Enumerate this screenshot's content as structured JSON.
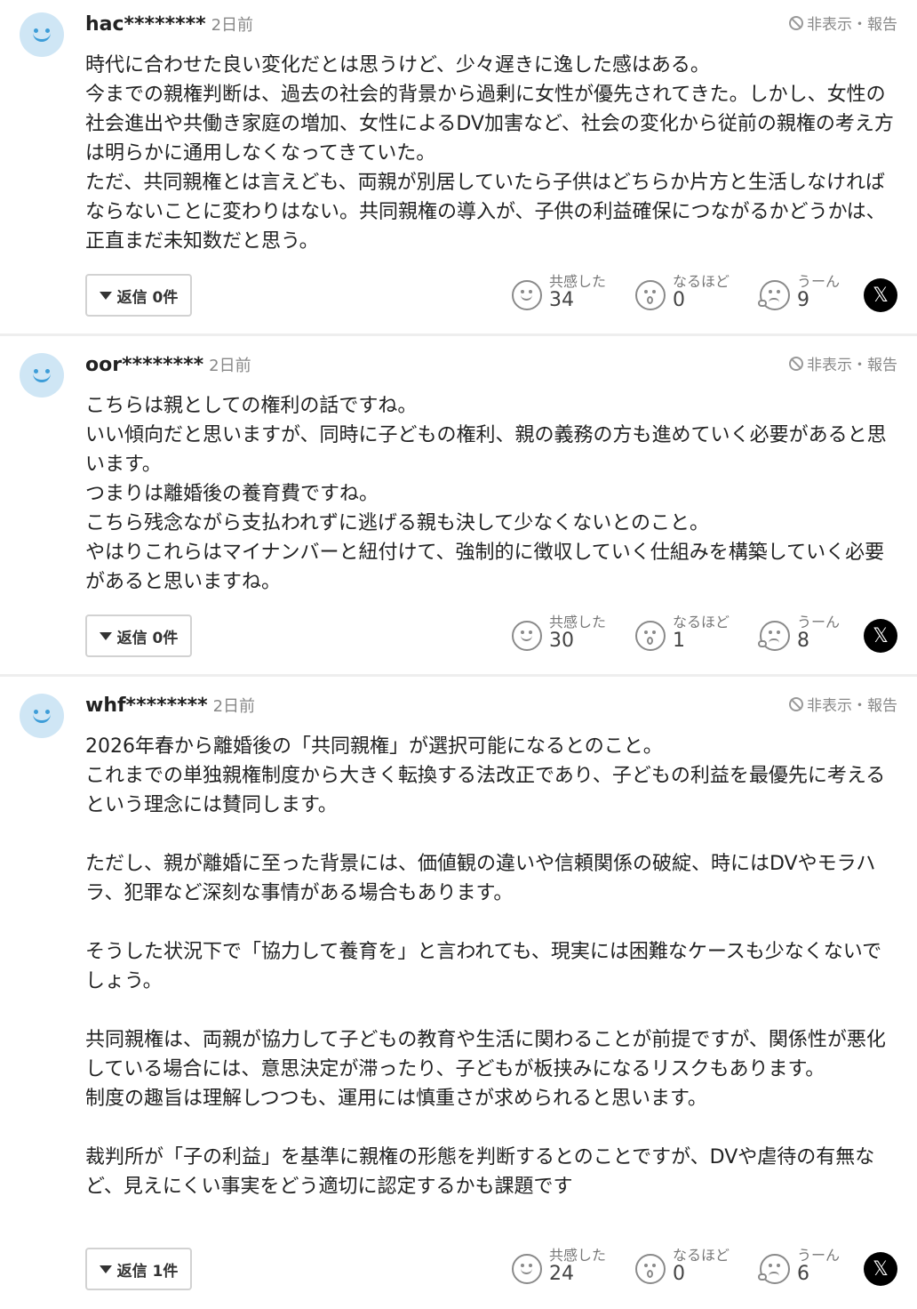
{
  "ui": {
    "hide_report_label": "非表示・報告",
    "reaction_labels": [
      "共感した",
      "なるほど",
      "うーん"
    ],
    "share_icon": "x-logo-icon"
  },
  "comments": [
    {
      "user": "hac********",
      "time": "2日前",
      "body": "時代に合わせた良い変化だとは思うけど、少々遅きに逸した感はある。\n今までの親権判断は、過去の社会的背景から過剰に女性が優先されてきた。しかし、女性の社会進出や共働き家庭の増加、女性によるDV加害など、社会の変化から従前の親権の考え方は明らかに通用しなくなってきていた。\nただ、共同親権とは言えども、両親が別居していたら子供はどちらか片方と生活しなければならないことに変わりはない。共同親権の導入が、子供の利益確保につながるかどうかは、正直まだ未知数だと思う。",
      "reply_label": "返信 0件",
      "reactions": [
        "34",
        "0",
        "9"
      ]
    },
    {
      "user": "oor********",
      "time": "2日前",
      "body": "こちらは親としての権利の話ですね。\nいい傾向だと思いますが、同時に子どもの権利、親の義務の方も進めていく必要があると思います。\nつまりは離婚後の養育費ですね。\nこちら残念ながら支払われずに逃げる親も決して少なくないとのこと。\nやはりこれらはマイナンバーと紐付けて、強制的に徴収していく仕組みを構築していく必要があると思いますね。",
      "reply_label": "返信 0件",
      "reactions": [
        "30",
        "1",
        "8"
      ]
    },
    {
      "user": "whf********",
      "time": "2日前",
      "body": "2026年春から離婚後の「共同親権」が選択可能になるとのこと。\nこれまでの単独親権制度から大きく転換する法改正であり、子どもの利益を最優先に考えるという理念には賛同します。\n\nただし、親が離婚に至った背景には、価値観の違いや信頼関係の破綻、時にはDVやモラハラ、犯罪など深刻な事情がある場合もあります。\n\nそうした状況下で「協力して養育を」と言われても、現実には困難なケースも少なくないでしょう。\n\n共同親権は、両親が協力して子どもの教育や生活に関わることが前提ですが、関係性が悪化している場合には、意思決定が滞ったり、子どもが板挟みになるリスクもあります。\n制度の趣旨は理解しつつも、運用には慎重さが求められると思います。\n\n裁判所が「子の利益」を基準に親権の形態を判断するとのことですが、DVや虐待の有無など、見えにくい事実をどう適切に認定するかも課題です",
      "reply_label": "返信 1件",
      "reactions": [
        "24",
        "0",
        "6"
      ]
    }
  ]
}
